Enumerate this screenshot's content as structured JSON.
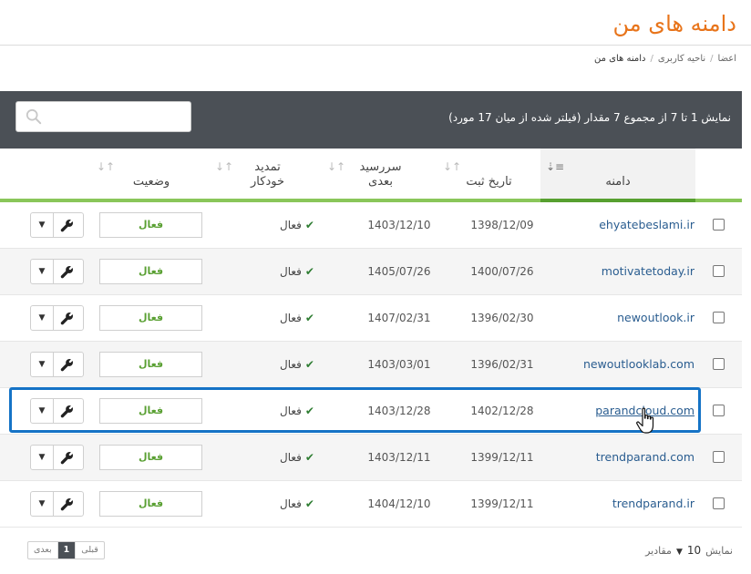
{
  "page_title": "دامنه های من",
  "breadcrumb": [
    "اعضا",
    "ناحیه کاربری",
    "دامنه های من"
  ],
  "summary": "نمایش 1 تا 7 از مجموع 7 مقدار (فیلتر شده از میان 17 مورد)",
  "search": {
    "value": "",
    "placeholder": ""
  },
  "columns": {
    "domain": "دامنه",
    "reg_date": "تاریخ ثبت",
    "next_due_line1": "سررسید",
    "next_due_line2": "بعدی",
    "auto_renew_line1": "تمدید",
    "auto_renew_line2": "خودکار",
    "status": "وضعیت"
  },
  "rows": [
    {
      "domain": "ehyatebeslami.ir",
      "reg_date": "1398/12/09",
      "next_due": "1403/12/10",
      "auto_renew": "فعال",
      "status": "فعال"
    },
    {
      "domain": "motivatetoday.ir",
      "reg_date": "1400/07/26",
      "next_due": "1405/07/26",
      "auto_renew": "فعال",
      "status": "فعال"
    },
    {
      "domain": "newoutlook.ir",
      "reg_date": "1396/02/30",
      "next_due": "1407/02/31",
      "auto_renew": "فعال",
      "status": "فعال"
    },
    {
      "domain": "newoutlooklab.com",
      "reg_date": "1396/02/31",
      "next_due": "1403/03/01",
      "auto_renew": "فعال",
      "status": "فعال"
    },
    {
      "domain": "parandcloud.com",
      "reg_date": "1402/12/28",
      "next_due": "1403/12/28",
      "auto_renew": "فعال",
      "status": "فعال"
    },
    {
      "domain": "trendparand.com",
      "reg_date": "1399/12/11",
      "next_due": "1403/12/11",
      "auto_renew": "فعال",
      "status": "فعال"
    },
    {
      "domain": "trendparand.ir",
      "reg_date": "1399/12/11",
      "next_due": "1404/12/10",
      "auto_renew": "فعال",
      "status": "فعال"
    }
  ],
  "pagination": {
    "prev": "قبلی",
    "current": "1",
    "next": "بعدی"
  },
  "page_size": {
    "prefix": "نمایش",
    "value": "10",
    "suffix": "مقادیر"
  },
  "colors": {
    "accent_orange": "#e8741a",
    "header_dark": "#4b5056",
    "status_green": "#5aa033",
    "highlight_blue": "#1573c6",
    "link_blue": "#2a5d90"
  },
  "icons": {
    "search": "search-icon",
    "wrench": "wrench-icon",
    "caret": "caret-down-icon",
    "check": "check-icon",
    "cursor": "hand-pointer-icon"
  }
}
